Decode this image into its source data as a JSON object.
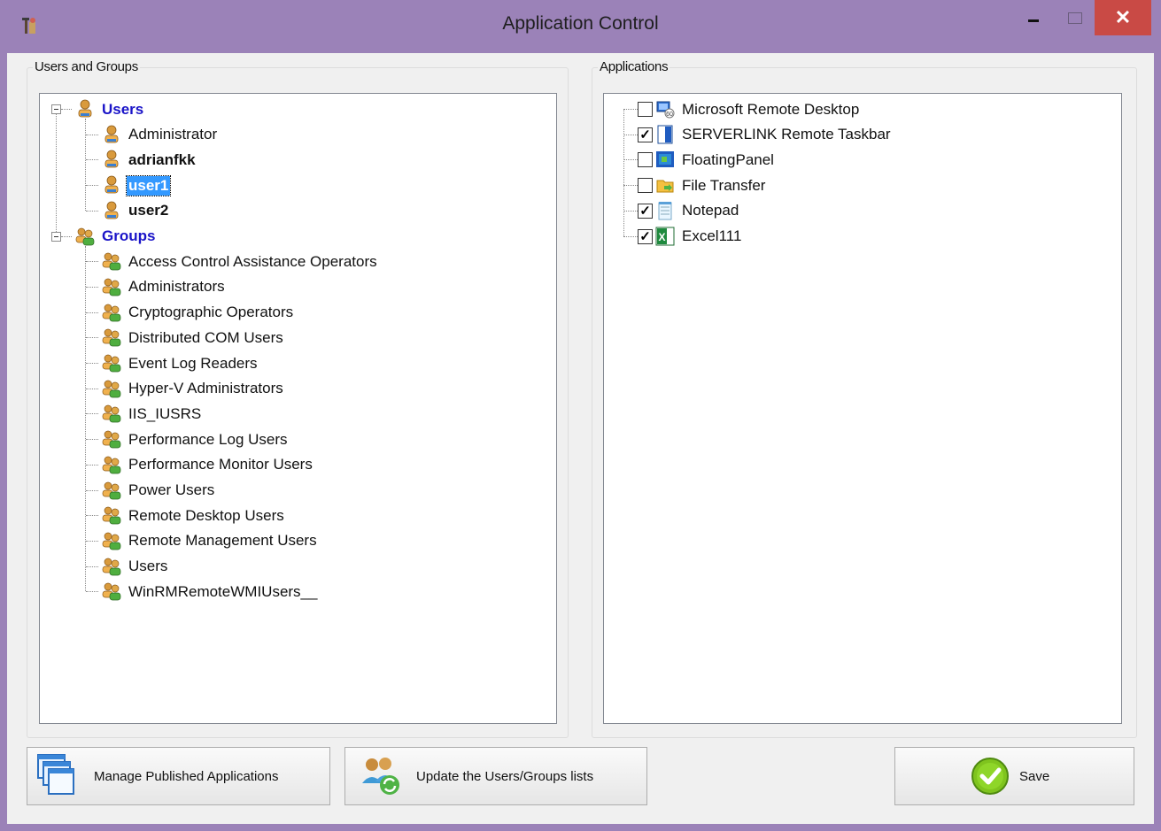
{
  "window": {
    "title": "Application Control",
    "close_glyph": "✕"
  },
  "users_groups": {
    "label": "Users and Groups",
    "users_root": "Users",
    "users": [
      {
        "name": "Administrator",
        "bold": false,
        "selected": false
      },
      {
        "name": "adrianfkk",
        "bold": true,
        "selected": false
      },
      {
        "name": "user1",
        "bold": true,
        "selected": true
      },
      {
        "name": "user2",
        "bold": true,
        "selected": false
      }
    ],
    "groups_root": "Groups",
    "groups": [
      "Access Control Assistance Operators",
      "Administrators",
      "Cryptographic Operators",
      "Distributed COM Users",
      "Event Log Readers",
      "Hyper-V Administrators",
      "IIS_IUSRS",
      "Performance Log Users",
      "Performance Monitor Users",
      "Power Users",
      "Remote Desktop Users",
      "Remote Management Users",
      "Users",
      "WinRMRemoteWMIUsers__"
    ]
  },
  "applications": {
    "label": "Applications",
    "items": [
      {
        "name": "Microsoft Remote Desktop",
        "checked": false,
        "icon": "remote-desktop-icon"
      },
      {
        "name": "SERVERLINK Remote Taskbar",
        "checked": true,
        "icon": "taskbar-icon"
      },
      {
        "name": "FloatingPanel",
        "checked": false,
        "icon": "floating-panel-icon"
      },
      {
        "name": "File Transfer",
        "checked": false,
        "icon": "file-transfer-icon"
      },
      {
        "name": "Notepad",
        "checked": true,
        "icon": "notepad-icon"
      },
      {
        "name": "Excel111",
        "checked": true,
        "icon": "excel-icon"
      }
    ]
  },
  "buttons": {
    "manage": "Manage Published Applications",
    "update": "Update the Users/Groups lists",
    "save": "Save"
  },
  "colors": {
    "title_bar": "#9b82b8",
    "close_button": "#c94a45",
    "selection": "#3399ff",
    "root_label": "#1a14c8"
  }
}
